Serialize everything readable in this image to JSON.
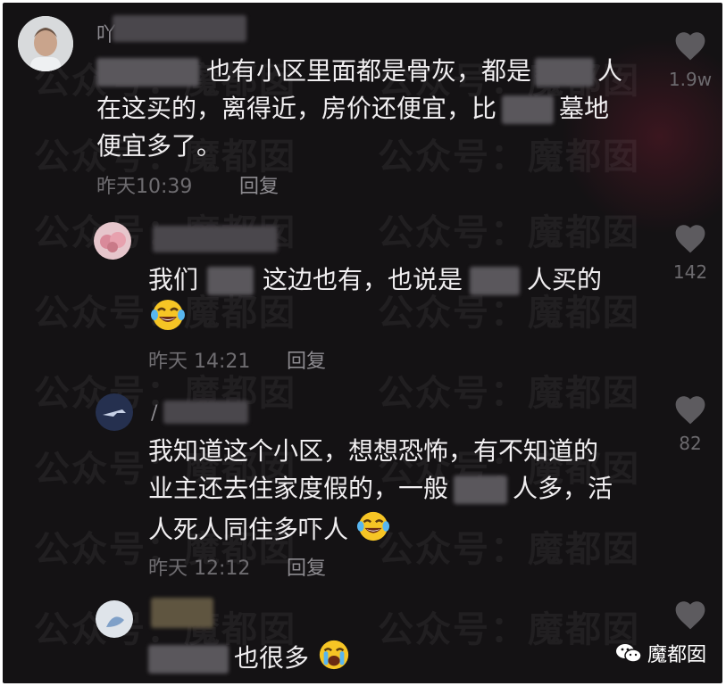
{
  "comments": [
    {
      "line1_a": "也有小区里面都是骨灰，都是",
      "line1_b": "人",
      "line2_a": "在这买的，离得近，房价还便宜，比",
      "line2_b": "墓地",
      "line3": "便宜多了。",
      "time": "昨天10:39",
      "reply": "回复",
      "likes": "1.9w",
      "name_initial": "吖"
    },
    {
      "line1_a": "我们",
      "line1_b": "这边也有，也说是",
      "line1_c": "人买的",
      "time": "昨天 14:21",
      "reply": "回复",
      "likes": "142"
    },
    {
      "line1": "我知道这个小区，想想恐怖，有不知道的",
      "line2_a": "业主还去住家度假的，一般",
      "line2_b": "人多，活",
      "line3": "人死人同住多吓人",
      "time": "昨天 12:12",
      "reply": "回复",
      "likes": "82",
      "name_initial": "/"
    },
    {
      "line1": "也很多"
    }
  ],
  "watermark": "公众号：魔都囡",
  "brand": "魔都囡",
  "icons": [
    "heart-icon",
    "laugh-cry-emoji",
    "wechat-icon"
  ]
}
